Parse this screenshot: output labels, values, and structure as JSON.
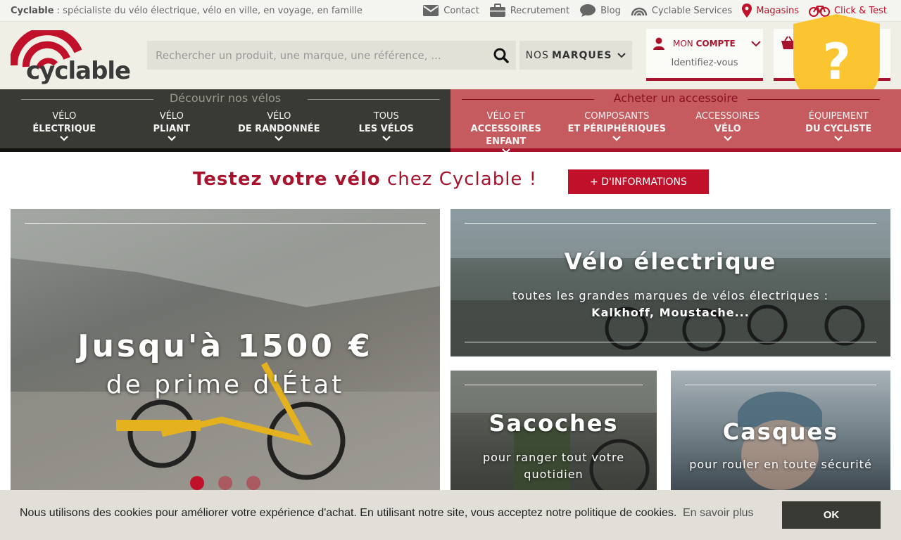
{
  "topbar": {
    "brand": "Cyclable",
    "tagline": " : spécialiste du vélo électrique, vélo en ville, en voyage, en famille",
    "links": [
      {
        "label": "Contact",
        "icon": "envelope-icon"
      },
      {
        "label": "Recrutement",
        "icon": "briefcase-icon"
      },
      {
        "label": "Blog",
        "icon": "chat-bubble-icon"
      },
      {
        "label": "Cyclable Services",
        "icon": "services-icon"
      },
      {
        "label": "Magasins",
        "icon": "map-marker-icon"
      },
      {
        "label": "Click & Test",
        "icon": "bicycle-icon"
      }
    ]
  },
  "header": {
    "logo_text": "cyclable",
    "search_placeholder": "Rechercher un produit, une marque, une référence, ...",
    "brands_prefix": "NOS",
    "brands_label": "MARQUES",
    "account_prefix": "MON",
    "account_label": "COMPTE",
    "account_sub": "Identifiez-vous",
    "help_symbol": "?"
  },
  "nav": {
    "bikes_heading": "Découvrir nos vélos",
    "accessories_heading": "Acheter un accessoire",
    "bikes": [
      {
        "l1": "Vélo",
        "l2": "électrique"
      },
      {
        "l1": "Vélo",
        "l2": "pliant"
      },
      {
        "l1": "Vélo",
        "l2": "de randonnée"
      },
      {
        "l1": "Tous",
        "l2": "les vélos"
      }
    ],
    "accessories": [
      {
        "l1": "Vélo et",
        "l2": "accessoires enfant"
      },
      {
        "l1": "Composants",
        "l2": "et périphériques"
      },
      {
        "l1": "Accessoires",
        "l2": "vélo"
      },
      {
        "l1": "Équipement",
        "l2": "du cycliste"
      }
    ]
  },
  "test_banner": {
    "title_bold": "Testez votre vélo",
    "title_rest": " chez Cyclable !",
    "button": "+ D'INFORMATIONS"
  },
  "tiles": {
    "hero": {
      "title": "Jusqu'à 1500 €",
      "subtitle": "de prime d'État"
    },
    "velo": {
      "title": "Vélo électrique",
      "desc": "toutes les grandes marques de vélos électriques : ",
      "desc_bold": "Kalkhoff, Moustache..."
    },
    "sacoches": {
      "title": "Sacoches",
      "desc": "pour ranger tout votre quotidien"
    },
    "casques": {
      "title": "Casques",
      "desc": "pour rouler en toute sécurité"
    }
  },
  "cookie": {
    "message": "Nous utilisons des cookies pour améliorer votre expérience d'achat. En utilisant notre site, vous acceptez notre politique de cookies.",
    "more": "En savoir plus",
    "ok": "OK"
  },
  "colors": {
    "brand_red": "#c0102a",
    "dark_nav": "#3a3a34",
    "accessory_nav": "#c55a5f",
    "shield_yellow": "#fbc531"
  }
}
